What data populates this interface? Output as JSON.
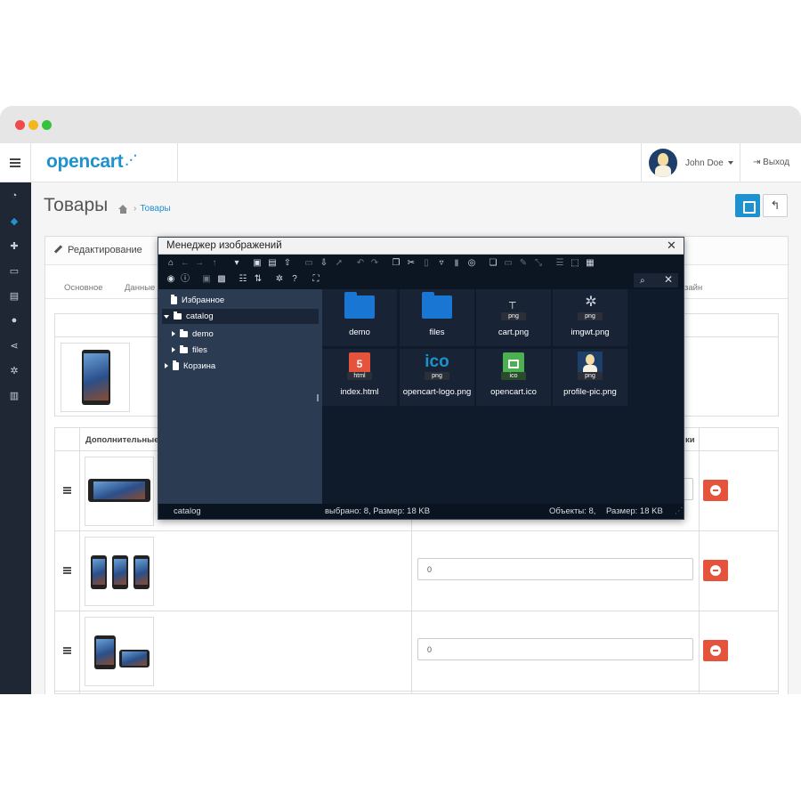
{
  "app": {
    "logo_text": "opencart",
    "user_name": "John Doe",
    "logout_label": "Выход"
  },
  "page": {
    "title": "Товары",
    "breadcrumb_current": "Товары",
    "panel_title": "Редактирование",
    "tabs": [
      "Основное",
      "Данные",
      "зайн"
    ],
    "table_header_images": "Дополнительные",
    "table_header_sort": "ки",
    "sort_values": [
      "0",
      "0"
    ]
  },
  "modal": {
    "title": "Менеджер изображений",
    "tree": [
      {
        "label": "Избранное"
      },
      {
        "label": "catalog"
      },
      {
        "label": "demo"
      },
      {
        "label": "files"
      },
      {
        "label": "Корзина"
      }
    ],
    "files": [
      {
        "name": "demo",
        "kind": "folder"
      },
      {
        "name": "files",
        "kind": "folder"
      },
      {
        "name": "cart.png",
        "kind": "image",
        "badge": "png"
      },
      {
        "name": "imgwt.png",
        "kind": "image",
        "badge": "png"
      },
      {
        "name": "index.html",
        "kind": "html",
        "badge": "html"
      },
      {
        "name": "opencart-logo.png",
        "kind": "image",
        "badge": "png"
      },
      {
        "name": "opencart.ico",
        "kind": "ico",
        "badge": "ico"
      },
      {
        "name": "profile-pic.png",
        "kind": "image",
        "badge": "png"
      }
    ],
    "status_path": "catalog",
    "status_selected": "выбрано: 8, Размер: 18 KB",
    "status_objects": "Объекты: 8,",
    "status_size": "Размер: 18 KB",
    "ico_logo_text": "ico"
  },
  "colors": {
    "accent": "#1e91cf",
    "sidebar": "#1f2735",
    "danger": "#e5533d",
    "modal_bg": "#0f1b2a",
    "tree_bg": "#2b3b52",
    "folder": "#1976d2"
  }
}
